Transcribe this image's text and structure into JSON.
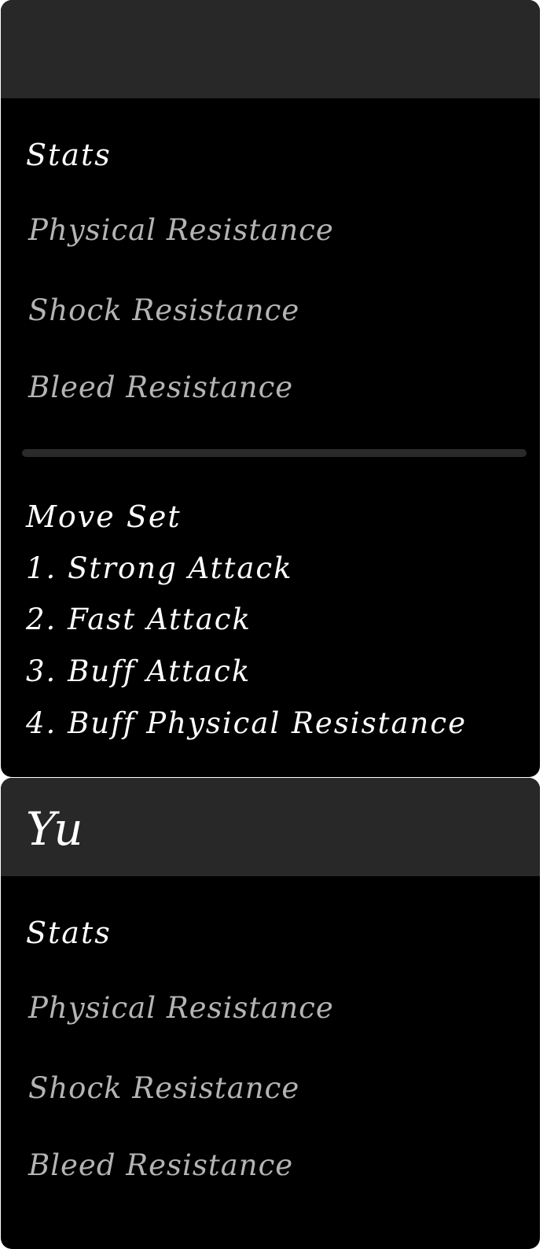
{
  "cards": [
    {
      "name": "",
      "stats_title": "Stats",
      "stats": [
        "Physical Resistance",
        "Shock Resistance",
        "Bleed Resistance"
      ],
      "moves_title": "Move Set",
      "moves": [
        "1. Strong Attack",
        "2. Fast Attack",
        "3. Buff Attack",
        "4. Buff Physical Resistance"
      ]
    },
    {
      "name": "Yu",
      "stats_title": "Stats",
      "stats": [
        "Physical Resistance",
        "Shock Resistance",
        "Bleed Resistance"
      ]
    }
  ],
  "colors": {
    "header_bg": "#282828",
    "card_bg": "#000000",
    "title_text": "#ffffff",
    "stat_text": "#b4b4b4",
    "divider": "#2a2a2a"
  }
}
